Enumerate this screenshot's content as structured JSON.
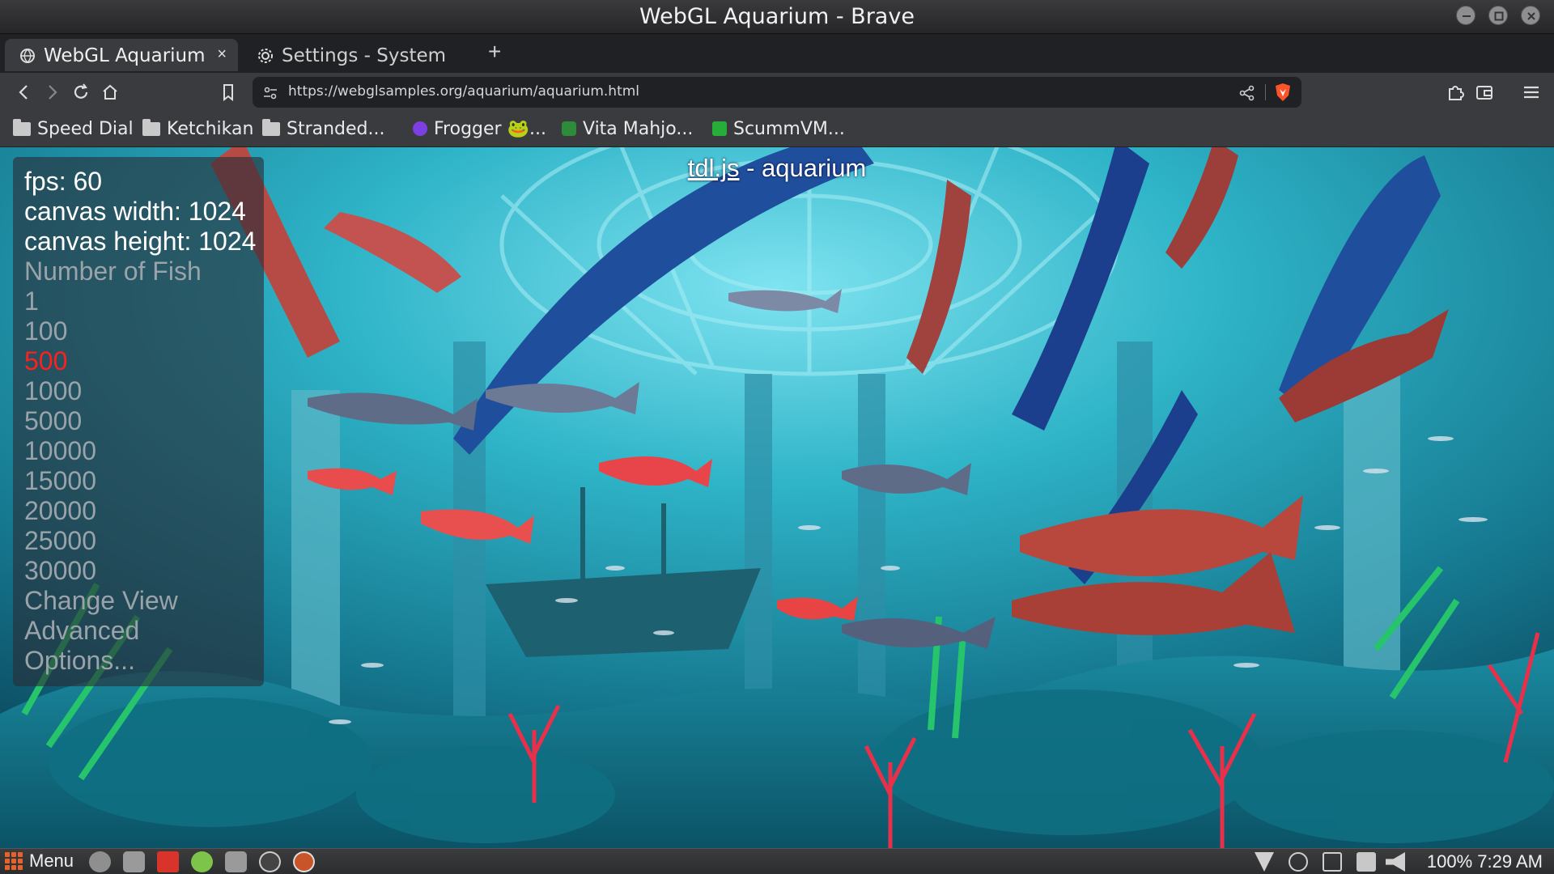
{
  "window": {
    "title": "WebGL Aquarium - Brave"
  },
  "tabs": [
    {
      "label": "WebGL Aquarium",
      "active": true,
      "close": "×"
    },
    {
      "label": "Settings - System",
      "active": false
    }
  ],
  "new_tab_label": "+",
  "address_bar": {
    "url": "https://webglsamples.org/aquarium/aquarium.html"
  },
  "bookmarks": [
    {
      "label": "Speed Dial",
      "icon": "folder-icon"
    },
    {
      "label": "Ketchikan",
      "icon": "folder-icon"
    },
    {
      "label": "Stranded...",
      "icon": "folder-icon"
    },
    {
      "label": "Frogger 🐸...",
      "icon": "purple-circle-favicon"
    },
    {
      "label": "Vita Mahjo...",
      "icon": "mahjong-favicon"
    },
    {
      "label": "ScummVM...",
      "icon": "scummvm-favicon"
    }
  ],
  "page": {
    "header_link": "tdl.js",
    "header_suffix": " - aquarium",
    "stats": {
      "fps": "fps: 60",
      "canvas_width": "canvas width: 1024",
      "canvas_height": "canvas height: 1024"
    },
    "fish_label": "Number of Fish",
    "fish_options": [
      "1",
      "100",
      "500",
      "1000",
      "5000",
      "10000",
      "15000",
      "20000",
      "25000",
      "30000"
    ],
    "selected_fish": "500",
    "change_view": "Change View",
    "advanced": "Advanced",
    "options": "Options..."
  },
  "taskbar": {
    "menu_label": "Menu",
    "battery": "100%",
    "clock": "7:29 AM"
  },
  "colors": {
    "selected_option": "#ff1f1f",
    "water": "#1e9bb0",
    "menu_accent": "#e8632b"
  }
}
